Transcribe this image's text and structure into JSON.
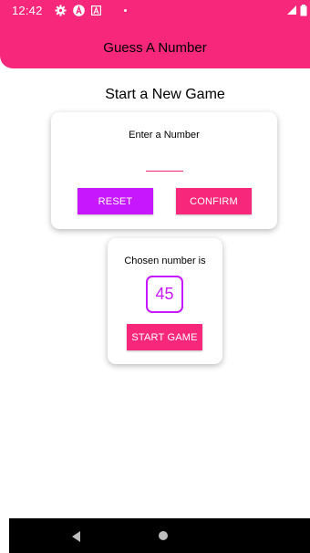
{
  "status_bar": {
    "time": "12:42",
    "icons": [
      "gear-icon",
      "a-circle-icon",
      "a-box-icon",
      "dot-icon",
      "signal-icon",
      "battery-icon"
    ]
  },
  "header": {
    "title": "Guess A Number",
    "color": "#f7287b"
  },
  "main": {
    "title": "Start a New Game",
    "input_card": {
      "label": "Enter a Number",
      "input_value": "",
      "input_placeholder": "",
      "reset_label": "RESET",
      "confirm_label": "CONFIRM"
    },
    "summary_card": {
      "label": "Chosen number is",
      "number": "45",
      "start_label": "START GAME"
    }
  },
  "colors": {
    "primary": "#f7287b",
    "accent": "#c717fc"
  },
  "nav_bar": {
    "icons": [
      "back-icon",
      "home-icon"
    ]
  }
}
